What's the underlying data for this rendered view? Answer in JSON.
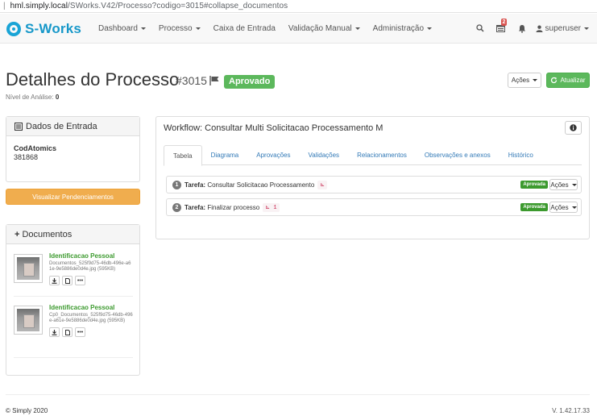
{
  "browser": {
    "url_host": "hml.simply.local",
    "url_path": "/SWorks.V42/Processo?codigo=3015#collapse_documentos"
  },
  "navbar": {
    "brand": "S-Works",
    "menu": [
      "Dashboard",
      "Processo",
      "Caixa de Entrada",
      "Validação Manual",
      "Administração"
    ],
    "notifications_count": "2",
    "user": "superuser"
  },
  "header": {
    "title": "Detalhes do Processo",
    "id": "#3015",
    "status": "Aprovado",
    "nivel_label": "Nível de Análise:",
    "nivel_value": "0",
    "acoes_label": "Ações",
    "atualizar_label": "Atualizar"
  },
  "dados": {
    "heading": "Dados de Entrada",
    "field_label": "CodAtomics",
    "field_value": "381868"
  },
  "pendencias_label": "Visualizar Pendenciamentos",
  "documentos": {
    "heading": "Documentos",
    "items": [
      {
        "title": "Identificacao Pessoal",
        "file": "Documentos_525f9d75-46db-496e-a61e-9e5886de0d4e.jpg (595KB)"
      },
      {
        "title": "Identificacao Pessoal",
        "file": "Cp0_Documentos_525f9d75-46db-496e-a61e-9e5886de0d4e.jpg (595KB)"
      }
    ]
  },
  "workflow": {
    "title": "Workflow: Consultar Multi Solicitacao Processamento M",
    "tabs": [
      "Tabela",
      "Diagrama",
      "Aprovações",
      "Validações",
      "Relacionamentos",
      "Observações e anexos",
      "Histórico"
    ],
    "tasks": [
      {
        "num": "1",
        "label": "Tarefa:",
        "name": "Consultar Solicitacao Processamento",
        "code": "",
        "status": "Aprovada",
        "acoes": "Ações"
      },
      {
        "num": "2",
        "label": "Tarefa:",
        "name": "Finalizar processo",
        "code": "1",
        "status": "Aprovada",
        "acoes": "Ações"
      }
    ]
  },
  "footer": {
    "copyright": "© Simply 2020",
    "version": "V. 1.42.17.33"
  },
  "colors": {
    "brand": "#1798c9",
    "success": "#5cb85c",
    "warning": "#f0ad4e",
    "danger": "#d9534f",
    "link": "#337ab7"
  }
}
